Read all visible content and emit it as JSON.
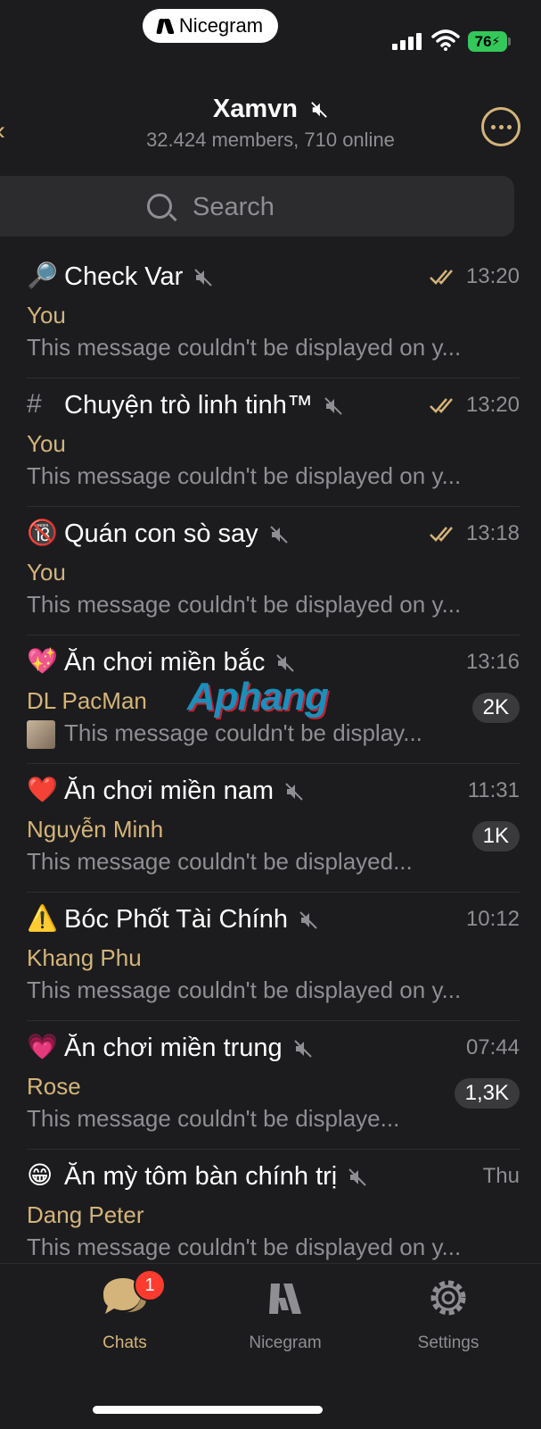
{
  "status_bar": {
    "app_pill": "Nicegram",
    "battery": "76"
  },
  "header": {
    "title": "Xamvn",
    "subtitle": "32.424 members, 710 online"
  },
  "search": {
    "placeholder": "Search"
  },
  "chats": [
    {
      "icon": "🔎",
      "icon_name": "magnifier-icon",
      "name": "Check Var",
      "time": "13:20",
      "read": true,
      "sender": "You",
      "preview": "This message couldn't be displayed on y...",
      "badge": ""
    },
    {
      "icon": "#",
      "icon_name": "hashtag-icon",
      "name": "Chuyện trò linh tinh™",
      "time": "13:20",
      "read": true,
      "sender": "You",
      "preview": "This message couldn't be displayed on y...",
      "badge": ""
    },
    {
      "icon": "🔞",
      "icon_name": "no-under-eighteen-icon",
      "name": "Quán con sò say",
      "time": "13:18",
      "read": true,
      "sender": "You",
      "preview": "This message couldn't be displayed on y...",
      "badge": ""
    },
    {
      "icon": "💖",
      "icon_name": "sparkling-heart-icon",
      "name": "Ăn chơi miền bắc",
      "time": "13:16",
      "read": false,
      "sender": "DL PacMan",
      "preview": "This message couldn't be display...",
      "badge": "2K",
      "thumb": true
    },
    {
      "icon": "❤️",
      "icon_name": "red-heart-icon",
      "name": "Ăn chơi miền nam",
      "time": "11:31",
      "read": false,
      "sender": "Nguyễn Minh",
      "preview": "This message couldn't be displayed...",
      "badge": "1K"
    },
    {
      "icon": "⚠️",
      "icon_name": "warning-icon",
      "name": "Bóc Phốt Tài Chính",
      "time": "10:12",
      "read": false,
      "sender": "Khang Phu",
      "preview": "This message couldn't be displayed on y...",
      "badge": ""
    },
    {
      "icon": "💗",
      "icon_name": "heart-icon",
      "name": "Ăn chơi miền trung",
      "time": "07:44",
      "read": false,
      "sender": "Rose",
      "preview": "This message couldn't be displaye...",
      "badge": "1,3K"
    },
    {
      "icon": "😁",
      "icon_name": "grinning-face-icon",
      "name": "Ăn mỳ tôm bàn chính trị",
      "time": "Thu",
      "read": false,
      "sender": "Dang Peter",
      "preview": "This message couldn't be displayed on y...",
      "badge": ""
    }
  ],
  "watermark": "Aphang",
  "tabs": [
    {
      "label": "Chats",
      "badge": "1",
      "active": true
    },
    {
      "label": "Nicegram",
      "active": false
    },
    {
      "label": "Settings",
      "active": false
    }
  ],
  "colors": {
    "accent": "#d4b47a",
    "background": "#1c1c1e",
    "secondary_text": "#8e8e93"
  }
}
